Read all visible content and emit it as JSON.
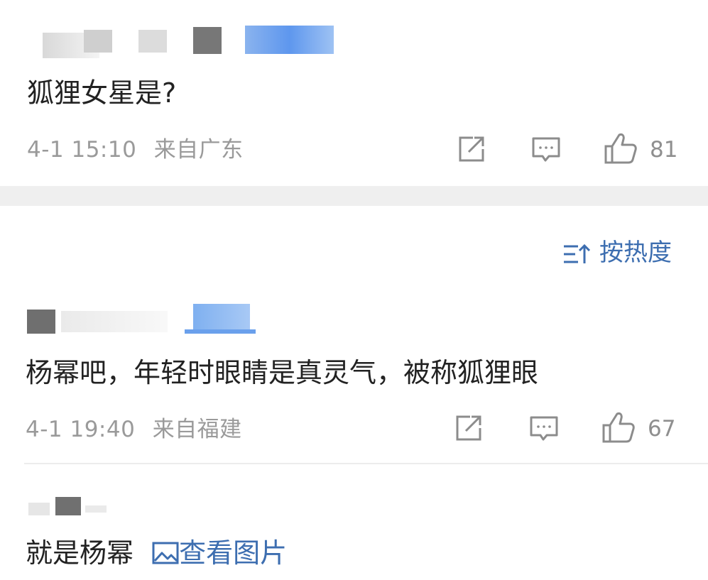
{
  "post": {
    "text": "狐狸女星是?",
    "time": "4-1 15:10",
    "location": "来自广东",
    "likes": "81"
  },
  "sort": {
    "label": "按热度"
  },
  "comments": [
    {
      "text": "杨幂吧，年轻时眼睛是真灵气，被称狐狸眼",
      "time": "4-1 19:40",
      "location": "来自福建",
      "likes": "67"
    },
    {
      "text": "就是杨幂",
      "link_label": "查看图片"
    }
  ],
  "icons": {
    "share": "share-icon",
    "comment": "comment-icon",
    "like": "thumbs-up-icon",
    "sort": "sort-icon",
    "image": "image-icon"
  },
  "colors": {
    "accent": "#3d6eb0",
    "meta": "#9a9a9a",
    "divider": "#efefef"
  }
}
